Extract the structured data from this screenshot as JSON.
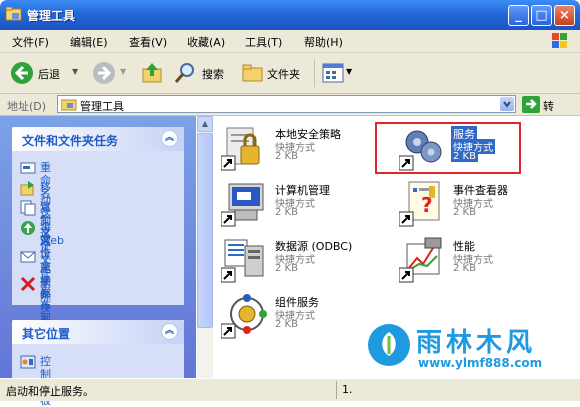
{
  "window": {
    "title": "管理工具"
  },
  "menu": [
    "文件(F)",
    "编辑(E)",
    "查看(V)",
    "收藏(A)",
    "工具(T)",
    "帮助(H)"
  ],
  "toolbar": {
    "back_label": "后退",
    "search_label": "搜索",
    "folders_label": "文件夹"
  },
  "address": {
    "label": "地址(D)",
    "value": "管理工具",
    "go_label": "转到"
  },
  "tasks_panel": {
    "title": "文件和文件夹任务",
    "items": [
      {
        "label": "重命名这个文件",
        "icon": "rename-icon"
      },
      {
        "label": "移动这个文件",
        "icon": "move-icon"
      },
      {
        "label": "复制这个文件",
        "icon": "copy-icon"
      },
      {
        "label": "将这个文件发布到",
        "label2": "Web",
        "icon": "publish-web-icon"
      },
      {
        "label": "以电子邮件形式发送",
        "label2": "此文件",
        "icon": "email-icon"
      },
      {
        "label": "删除这个文件",
        "icon": "delete-icon"
      }
    ]
  },
  "places_panel": {
    "title": "其它位置",
    "items": [
      {
        "label": "控制面板",
        "icon": "control-panel-icon"
      }
    ]
  },
  "files": [
    {
      "name": "本地安全策略",
      "type": "快捷方式",
      "size": "2 KB",
      "icon": "local-security-policy-icon"
    },
    {
      "name": "服务",
      "type": "快捷方式",
      "size": "2 KB",
      "icon": "services-icon",
      "selected": true
    },
    {
      "name": "计算机管理",
      "type": "快捷方式",
      "size": "2 KB",
      "icon": "computer-management-icon"
    },
    {
      "name": "事件查看器",
      "type": "快捷方式",
      "size": "2 KB",
      "icon": "event-viewer-icon"
    },
    {
      "name": "数据源 (ODBC)",
      "type": "快捷方式",
      "size": "2 KB",
      "icon": "odbc-icon"
    },
    {
      "name": "性能",
      "type": "快捷方式",
      "size": "2 KB",
      "icon": "performance-icon"
    },
    {
      "name": "组件服务",
      "type": "快捷方式",
      "size": "2 KB",
      "icon": "component-services-icon"
    }
  ],
  "status": {
    "text": "启动和停止服务。",
    "pane2": "1."
  },
  "watermark": {
    "title": "雨林木风",
    "url": "www.ylmf888.com"
  },
  "colors": {
    "titlebar": "#2468d8",
    "selection": "#316ac5",
    "highlight_box": "#e0262a",
    "link": "#215dc6"
  }
}
